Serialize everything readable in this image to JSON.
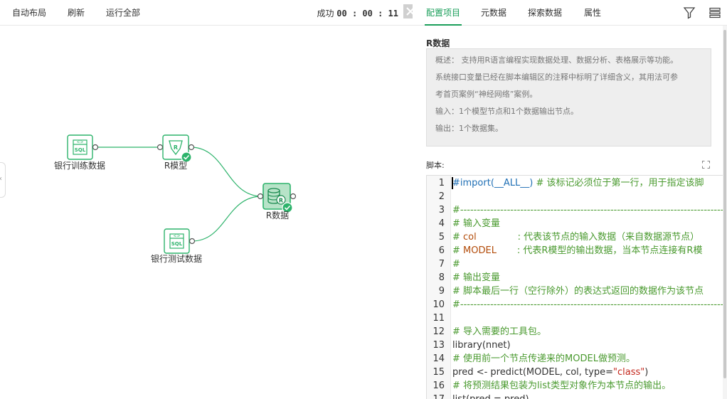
{
  "toolbar": {
    "auto_layout": "自动布局",
    "refresh": "刷新",
    "run_all": "运行全部",
    "status_label": "成功",
    "status_time": "00 : 00 : 11"
  },
  "nodes": {
    "train": "银行训练数据",
    "model": "R模型",
    "rdata": "R数据",
    "test": "银行测试数据",
    "sql_tag": "SQL"
  },
  "tabs": [
    "配置项目",
    "元数据",
    "探索数据",
    "属性"
  ],
  "active_tab": "配置项目",
  "section": {
    "title": "R数据",
    "desc": [
      "概述：  支持用R语言编程实现数据处理、数据分析、表格展示等功能。",
      "系统接口变量已经在脚本编辑区的注释中标明了详细含义，其用法可参",
      "考首页案例“神经网络”案例。",
      "输入：1个模型节点和1个数据输出节点。",
      "输出：1个数据集。"
    ]
  },
  "script_label": "脚本:",
  "editor": {
    "line_numbers": [
      "1",
      "2",
      "3",
      "4",
      "5",
      "6",
      "7",
      "8",
      "9",
      "10",
      "11",
      "12",
      "13",
      "14",
      "15",
      "16",
      "17"
    ],
    "lines": {
      "l1_kw": "#import(__ALL__)",
      "l1_cmt": " # 该标记必须位于第一行，用于指定该脚",
      "l3": "#--------------------------------------------------------------------------------",
      "l4": "# 输入变量",
      "l5_a": "# ",
      "l5_var": "col",
      "l5_b": "              : 代表该节点的输入数据（来自数据源节点）",
      "l6_a": "# ",
      "l6_var": "MODEL",
      "l6_b": "       : 代表R模型的输出数据，当本节点连接有R模",
      "l7": "#",
      "l8": "# 输出变量",
      "l9": "# 脚本最后一行（空行除外）的表达式返回的数据作为该节点",
      "l10": "#--------------------------------------------------------------------------------",
      "l12": "# 导入需要的工具包。",
      "l13": "library(nnet)",
      "l14": "# 使用前一个节点传递来的MODEL做预测。",
      "l15_a": "pred <- predict(MODEL, col, type=",
      "l15_str": "\"class\"",
      "l15_b": ")",
      "l16": "# 将预测结果包装为list类型对象作为本节点的输出。",
      "l17": "list(pred = pred)"
    }
  },
  "colors": {
    "accent": "#1a9e5a",
    "node_green": "#2db36b",
    "comment": "#4a9a2f",
    "keyword": "#1f6fb5",
    "variable": "#b34c0a",
    "string": "#c4281d"
  },
  "icons": [
    "collapse-x-icon",
    "filter-icon",
    "menu-icon",
    "expand-icon",
    "sql-db-icon",
    "r-model-icon",
    "r-data-icon",
    "check-icon"
  ]
}
